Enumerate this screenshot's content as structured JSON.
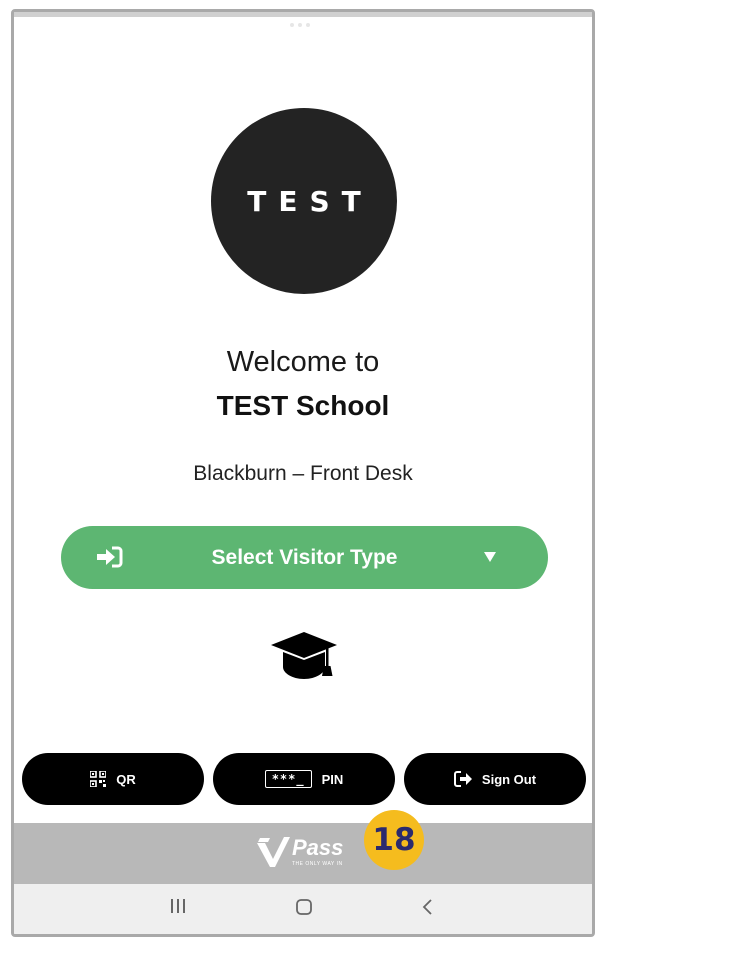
{
  "logo": {
    "text": "TEST"
  },
  "welcome": {
    "line1": "Welcome to",
    "school": "TEST School",
    "location": "Blackburn – Front Desk"
  },
  "visitor_button": {
    "label": "Select Visitor Type",
    "icon": "sign-in-icon",
    "dropdown_icon": "caret-down-icon"
  },
  "center_icon": "graduation-cap-icon",
  "actions": {
    "qr": {
      "label": "QR",
      "icon": "qr-code-icon"
    },
    "pin": {
      "label": "PIN",
      "icon_text": "***_"
    },
    "sign_out": {
      "label": "Sign Out",
      "icon": "sign-out-icon"
    }
  },
  "footer": {
    "brand_name": "Pass",
    "brand_tagline": "THE ONLY WAY IN",
    "badge": "18"
  },
  "navbar": {
    "items": [
      "recent-apps-icon",
      "home-icon",
      "back-icon"
    ]
  },
  "colors": {
    "accent_green": "#5db672",
    "badge_yellow": "#f5bc1e",
    "footer_gray": "#b8b8b8",
    "button_black": "#000000"
  }
}
